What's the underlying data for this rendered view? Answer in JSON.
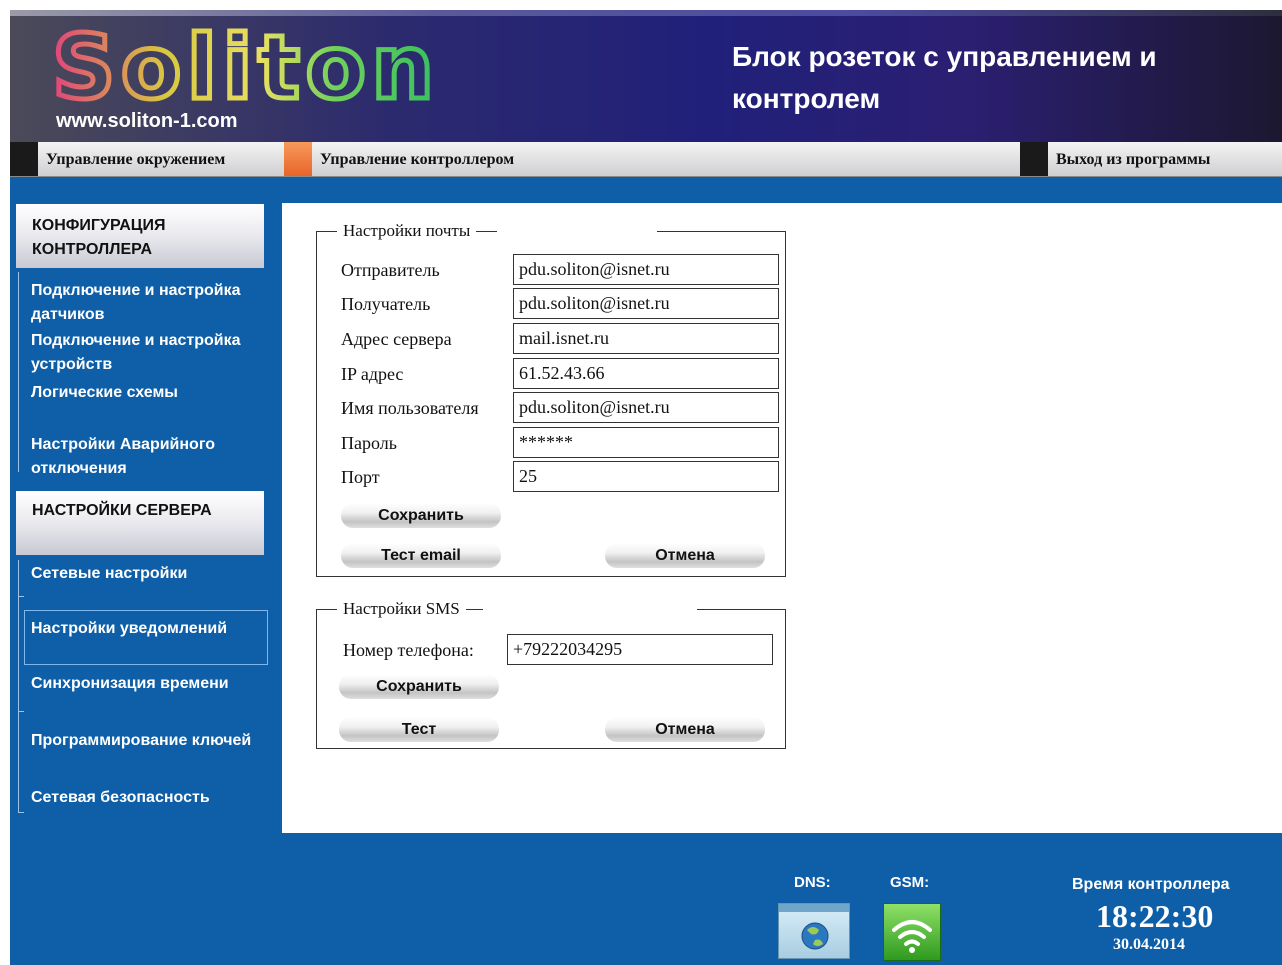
{
  "header": {
    "logo_text": "Soliton",
    "site_url": "www.soliton-1.com",
    "product_title": "Блок розеток с управлением и контролем"
  },
  "top_menu": [
    {
      "label": "Управление окружением",
      "square_color": "#1a1a1a"
    },
    {
      "label": "Управление контроллером",
      "square_color": "#f07a3a"
    },
    {
      "label": "Выход из программы",
      "square_color": "#1a1a1a"
    }
  ],
  "sidebar": {
    "section1_title": "КОНФИГУРАЦИЯ КОНТРОЛЛЕРА",
    "section1_items": [
      "Подключение и настройка датчиков",
      "Подключение и настройка устройств",
      "Логические схемы",
      "Настройки Аварийного отключения"
    ],
    "section2_title": "НАСТРОЙКИ СЕРВЕРА",
    "section2_items": [
      "Сетевые настройки",
      "Настройки уведомлений",
      "Синхронизация времени",
      "Программирование ключей",
      "Сетевая безопасность"
    ],
    "active_item": "Настройки уведомлений"
  },
  "mail_settings": {
    "title": "Настройки почты",
    "fields": [
      {
        "label": "Отправитель",
        "value": "pdu.soliton@isnet.ru"
      },
      {
        "label": "Получатель",
        "value": "pdu.soliton@isnet.ru"
      },
      {
        "label": "Адрес сервера",
        "value": "mail.isnet.ru"
      },
      {
        "label": "IP адрес",
        "value": "61.52.43.66"
      },
      {
        "label": "Имя пользователя",
        "value": "pdu.soliton@isnet.ru"
      },
      {
        "label": "Пароль",
        "value": "******"
      },
      {
        "label": "Порт",
        "value": "25"
      }
    ],
    "save_label": "Сохранить",
    "test_label": "Тест email",
    "cancel_label": "Отмена"
  },
  "sms_settings": {
    "title": "Настройки SMS",
    "phone_label": "Номер телефона:",
    "phone_value": "+79222034295",
    "save_label": "Сохранить",
    "test_label": "Тест",
    "cancel_label": "Отмена"
  },
  "status": {
    "dns_label": "DNS:",
    "gsm_label": "GSM:",
    "dns_icon": "globe-window-icon",
    "gsm_icon": "wifi-signal-icon"
  },
  "clock": {
    "title": "Время контроллера",
    "time": "18:22:30",
    "date": "30.04.2014"
  },
  "colors": {
    "background_blue": "#0f5fa8",
    "accent_orange": "#f07a3a"
  }
}
